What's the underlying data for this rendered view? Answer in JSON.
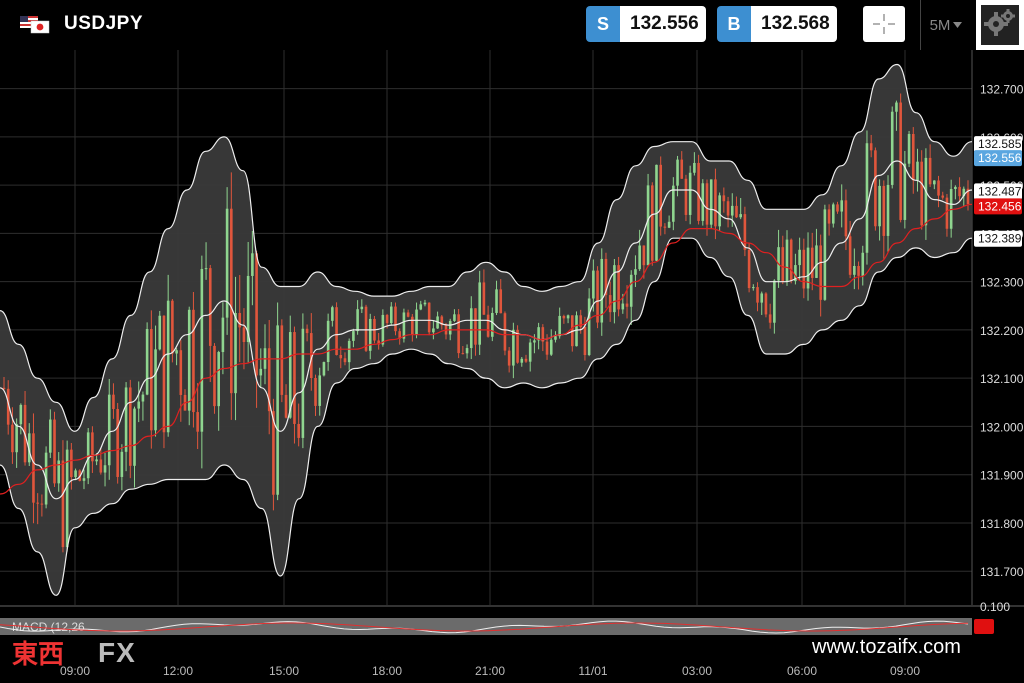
{
  "header": {
    "symbol": "USDJPY",
    "flag_icon": "us-jp-flag-icon",
    "sell": {
      "tag": "S",
      "price": "132.556"
    },
    "buy": {
      "tag": "B",
      "price": "132.568"
    },
    "timeframe": "5M"
  },
  "macd_label": "MACD (12,26",
  "watermark": {
    "kanji": "東西",
    "fx": "FX",
    "site": "www.tozaifx.com"
  },
  "colors": {
    "accent": "#3d8fd1",
    "ma": "#e02020",
    "band": "#3a3a3a",
    "bg": "#000000"
  },
  "chart_data": {
    "type": "candlestick",
    "ylim": [
      131.63,
      132.78
    ],
    "y_ticks": [
      "132.700",
      "132.600",
      "132.500",
      "132.400",
      "132.300",
      "132.200",
      "132.100",
      "132.000",
      "131.900",
      "131.800",
      "131.700"
    ],
    "y_tick_values": [
      132.7,
      132.6,
      132.5,
      132.4,
      132.3,
      132.2,
      132.1,
      132.0,
      131.9,
      131.8,
      131.7
    ],
    "x_ticks": [
      "09:00",
      "12:00",
      "15:00",
      "18:00",
      "21:00",
      "11/01",
      "03:00",
      "06:00",
      "09:00"
    ],
    "price_labels": [
      {
        "text": "132.585",
        "value": 132.585,
        "kind": "white"
      },
      {
        "text": "132.556",
        "value": 132.556,
        "kind": "blue"
      },
      {
        "text": "132.487",
        "value": 132.487,
        "kind": "white"
      },
      {
        "text": "132.456",
        "value": 132.456,
        "kind": "red"
      },
      {
        "text": "132.389",
        "value": 132.389,
        "kind": "white"
      }
    ],
    "macd_tick": "0.100",
    "middle_band": [
      132.08,
      132.0,
      131.92,
      131.85,
      131.89,
      131.94,
      131.99,
      132.05,
      132.1,
      132.15,
      132.19,
      132.23,
      132.26,
      132.21,
      132.08,
      131.99,
      132.07,
      132.16,
      132.19,
      132.2,
      132.2,
      132.21,
      132.22,
      132.22,
      132.21,
      132.22,
      132.22,
      132.2,
      132.19,
      132.18,
      132.19,
      132.2,
      132.26,
      132.32,
      132.38,
      132.44,
      132.49,
      132.49,
      132.45,
      132.43,
      132.37,
      132.3,
      132.3,
      132.31,
      132.34,
      132.38,
      132.43,
      132.52,
      132.55,
      132.51,
      132.47,
      132.46,
      132.49
    ],
    "band_width": [
      0.16,
      0.17,
      0.18,
      0.2,
      0.1,
      0.12,
      0.15,
      0.18,
      0.22,
      0.26,
      0.3,
      0.34,
      0.34,
      0.32,
      0.25,
      0.3,
      0.22,
      0.16,
      0.1,
      0.08,
      0.07,
      0.06,
      0.06,
      0.07,
      0.08,
      0.1,
      0.12,
      0.12,
      0.1,
      0.1,
      0.1,
      0.1,
      0.12,
      0.15,
      0.16,
      0.14,
      0.1,
      0.1,
      0.1,
      0.12,
      0.14,
      0.15,
      0.15,
      0.14,
      0.14,
      0.16,
      0.18,
      0.2,
      0.2,
      0.14,
      0.12,
      0.1,
      0.1
    ],
    "moving_average": [
      131.86,
      131.88,
      131.91,
      131.92,
      131.93,
      131.94,
      131.95,
      131.96,
      131.98,
      132.0,
      132.05,
      132.1,
      132.12,
      132.13,
      132.14,
      132.14,
      132.15,
      132.15,
      132.16,
      132.16,
      132.17,
      132.18,
      132.19,
      132.19,
      132.2,
      132.2,
      132.2,
      132.19,
      132.19,
      132.18,
      132.19,
      132.21,
      132.23,
      132.26,
      132.3,
      132.34,
      132.38,
      132.41,
      132.41,
      132.4,
      132.38,
      132.36,
      132.33,
      132.3,
      132.29,
      132.29,
      132.31,
      132.34,
      132.38,
      132.41,
      132.43,
      132.45,
      132.46
    ]
  }
}
